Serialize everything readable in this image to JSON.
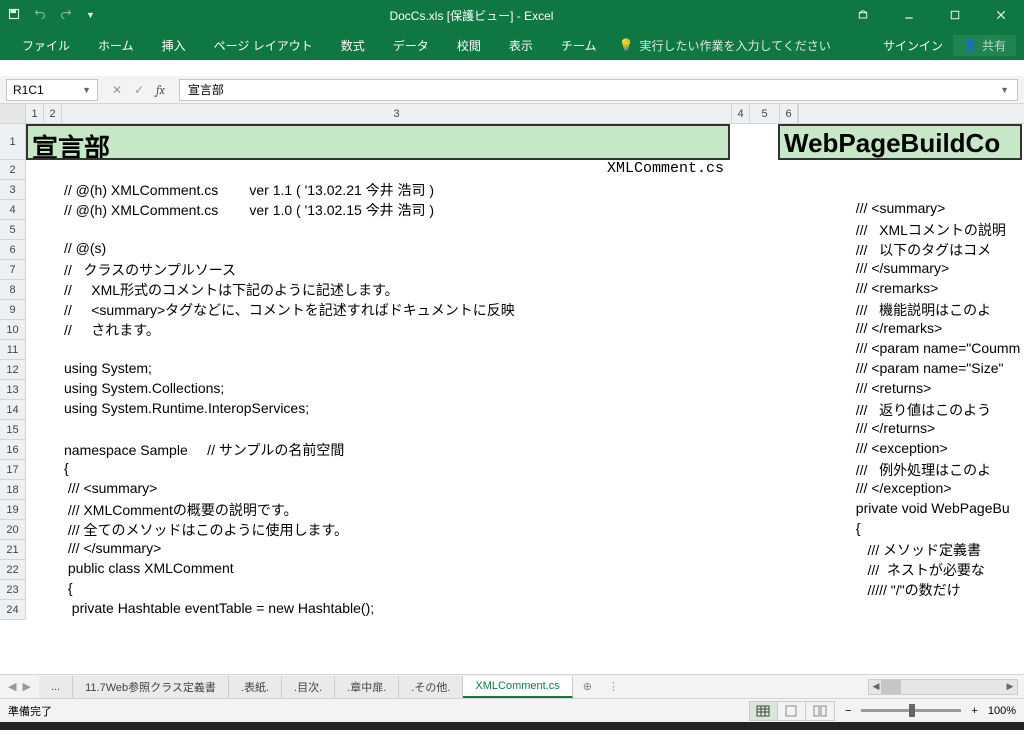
{
  "titlebar": {
    "title": "DocCs.xls [保護ビュー] - Excel"
  },
  "ribbon": {
    "tabs": [
      "ファイル",
      "ホーム",
      "挿入",
      "ページ レイアウト",
      "数式",
      "データ",
      "校閲",
      "表示",
      "チーム"
    ],
    "tellme": "実行したい作業を入力してください",
    "signin": "サインイン",
    "share": "共有"
  },
  "formula": {
    "namebox": "R1C1",
    "value": "宣言部"
  },
  "columns": {
    "labels": [
      "1",
      "2",
      "3",
      "4",
      "5",
      "6"
    ],
    "widths": [
      18,
      18,
      670,
      18,
      30,
      18
    ]
  },
  "rows": {
    "heights": [
      36,
      20,
      20,
      20,
      20,
      20,
      20,
      20,
      20,
      20,
      20,
      20,
      20,
      20,
      20,
      20,
      20,
      20,
      20,
      20,
      20,
      20,
      20,
      20
    ],
    "labels": [
      "1",
      "2",
      "3",
      "4",
      "5",
      "6",
      "7",
      "8",
      "9",
      "10",
      "11",
      "12",
      "13",
      "14",
      "15",
      "16",
      "17",
      "18",
      "19",
      "20",
      "21",
      "22",
      "23",
      "24"
    ]
  },
  "left": {
    "title": "宣言部",
    "filelabel": "XMLComment.cs",
    "code": [
      "",
      "// @(h) XMLComment.cs        ver 1.1 ( '13.02.21 今井 浩司 )",
      "// @(h) XMLComment.cs        ver 1.0 ( '13.02.15 今井 浩司 )",
      "",
      "// @(s)",
      "//   クラスのサンプルソース",
      "//     XML形式のコメントは下記のように記述します。",
      "//     <summary>タグなどに、コメントを記述すればドキュメントに反映",
      "//     されます。",
      "",
      "using System;",
      "using System.Collections;",
      "using System.Runtime.InteropServices;",
      "",
      "namespace Sample     // サンプルの名前空間",
      "{",
      " /// <summary>",
      " /// XMLCommentの概要の説明です。",
      " /// 全てのメソッドはこのように使用します。",
      " /// </summary>",
      " public class XMLComment",
      " {",
      "  private Hashtable eventTable = new Hashtable();"
    ]
  },
  "right": {
    "title": "WebPageBuildCo",
    "code": [
      "",
      "",
      "  /// <summary>",
      "  ///   XMLコメントの説明",
      "  ///   以下のタグはコメ",
      "  /// </summary>",
      "  /// <remarks>",
      "  ///   機能説明はこのよ",
      "  /// </remarks>",
      "  /// <param name=\"Coumm",
      "  /// <param name=\"Size\"",
      "  /// <returns>",
      "  ///   返り値はこのよう",
      "  /// </returns>",
      "  /// <exception>",
      "  ///   例外処理はこのよ",
      "  /// </exception>",
      "  private void WebPageBu",
      "  {",
      "     /// メソッド定義書",
      "     ///  ネストが必要な",
      "     ///// \"/\"の数だけ",
      ""
    ]
  },
  "sheettabs": {
    "tabs": [
      "...",
      "11.7Web参照クラス定義書",
      ".表紙.",
      ".目次.",
      ".章中扉.",
      ".その他.",
      "XMLComment.cs"
    ],
    "active": 6
  },
  "status": {
    "ready": "準備完了",
    "zoom": "100%",
    "minus": "−",
    "plus": "+"
  }
}
